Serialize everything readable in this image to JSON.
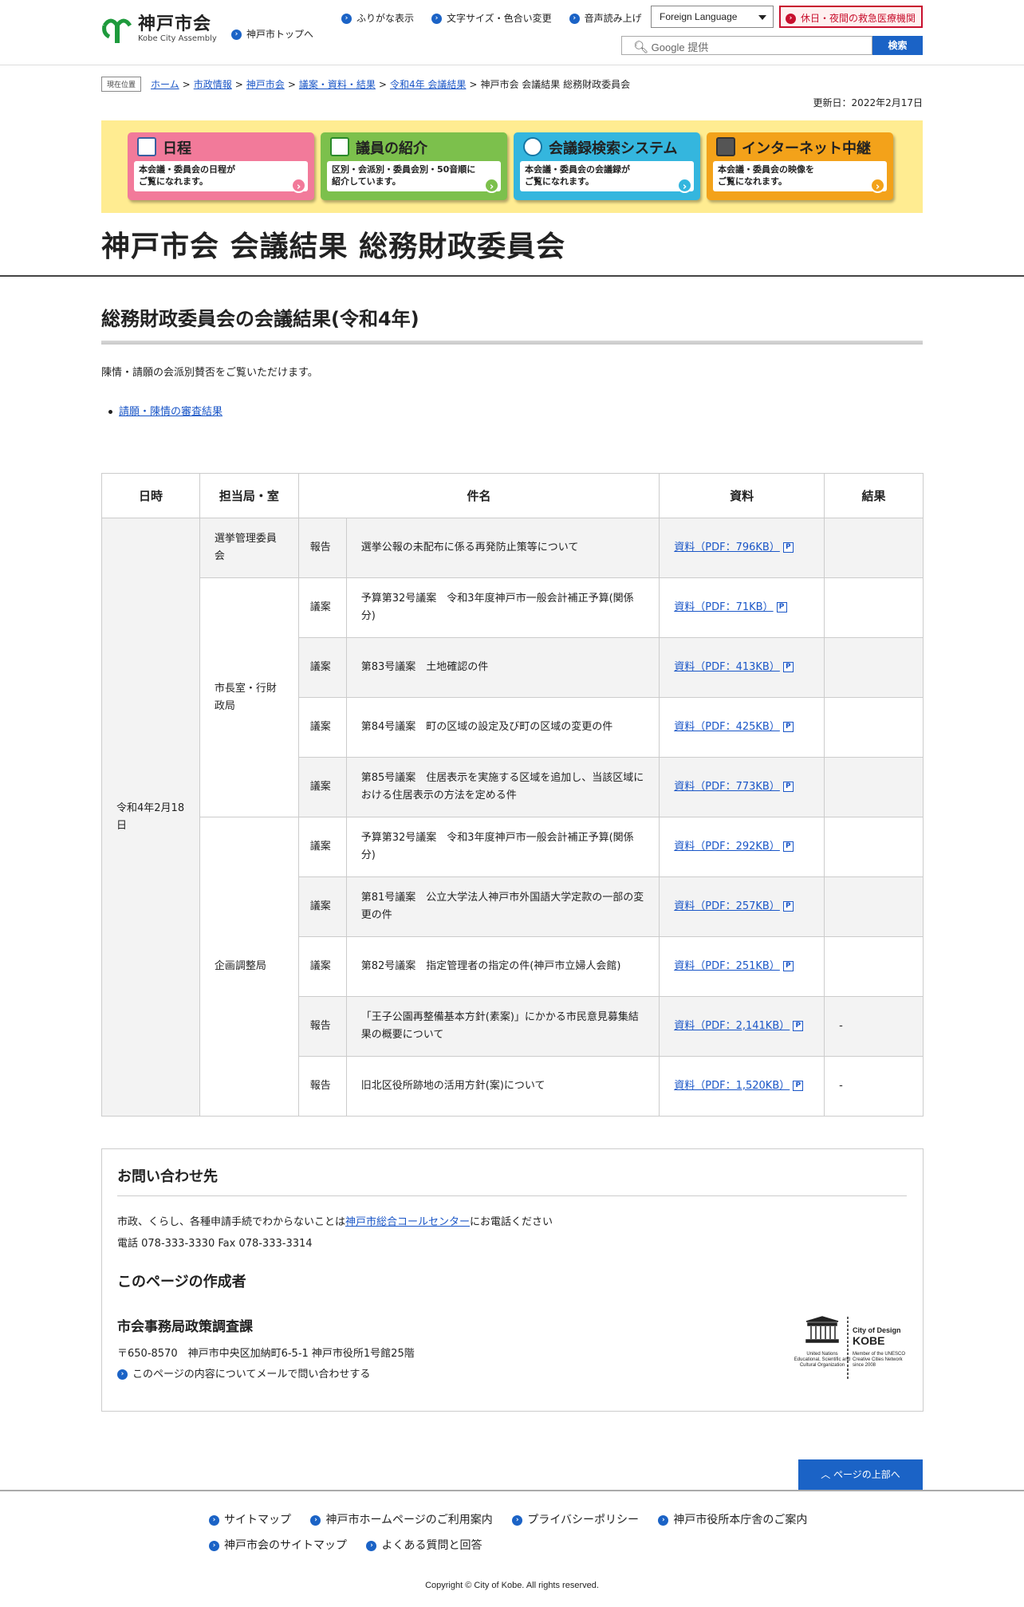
{
  "header": {
    "logo_title": "神戸市会",
    "logo_sub": "Kobe City Assembly",
    "top_link": "神戸市トップへ",
    "util": [
      "ふりがな表示",
      "文字サイズ・色合い変更",
      "音声読み上げ"
    ],
    "language": "Foreign Language",
    "emergency": "休日・夜間の救急医療機関",
    "search_placeholder": "Google 提供",
    "search_button": "検索"
  },
  "breadcrumb": {
    "here": "現在位置",
    "items": [
      "ホーム",
      "市政情報",
      "神戸市会",
      "議案・資料・結果",
      "令和4年 会議結果"
    ],
    "current": "神戸市会 会議結果 総務財政委員会"
  },
  "updated": "更新日：2022年2月17日",
  "banners": [
    {
      "title": "日程",
      "desc": "本会議・委員会の日程が\nご覧になれます。",
      "color": "#f27a9a"
    },
    {
      "title": "議員の紹介",
      "desc": "区別・会派別・委員会別・50音順に\n紹介しています。",
      "color": "#7cc04c"
    },
    {
      "title": "会議録検索システム",
      "desc": "本会議・委員会の会議録が\nご覧になれます。",
      "color": "#34b6de"
    },
    {
      "title": "インターネット中継",
      "desc": "本会議・委員会の映像を\nご覧になれます。",
      "color": "#f3a21a"
    }
  ],
  "page_title": "神戸市会 会議結果 総務財政委員会",
  "section_title": "総務財政委員会の会議結果(令和4年)",
  "intro": "陳情・請願の会派別賛否をご覧いただけます。",
  "petition_link": "請願・陳情の審査結果",
  "table": {
    "headers": [
      "日時",
      "担当局・室",
      "件名",
      "資料",
      "結果"
    ],
    "date": "令和4年2月18日",
    "depts": [
      "選挙管理委員会",
      "市長室・行財政局",
      "企画調整局"
    ],
    "rows": [
      {
        "type": "報告",
        "subject": "選挙公報の未配布に係る再発防止策等について",
        "doc": "資料（PDF：796KB）",
        "result": ""
      },
      {
        "type": "議案",
        "subject": "予算第32号議案　令和3年度神戸市一般会計補正予算(関係分)",
        "doc": "資料（PDF：71KB）",
        "result": ""
      },
      {
        "type": "議案",
        "subject": "第83号議案　土地確認の件",
        "doc": "資料（PDF：413KB）",
        "result": ""
      },
      {
        "type": "議案",
        "subject": "第84号議案　町の区域の設定及び町の区域の変更の件",
        "doc": "資料（PDF：425KB）",
        "result": ""
      },
      {
        "type": "議案",
        "subject": "第85号議案　住居表示を実施する区域を追加し、当該区域における住居表示の方法を定める件",
        "doc": "資料（PDF：773KB）",
        "result": ""
      },
      {
        "type": "議案",
        "subject": "予算第32号議案　令和3年度神戸市一般会計補正予算(関係分)",
        "doc": "資料（PDF：292KB）",
        "result": ""
      },
      {
        "type": "議案",
        "subject": "第81号議案　公立大学法人神戸市外国語大学定款の一部の変更の件",
        "doc": "資料（PDF：257KB）",
        "result": ""
      },
      {
        "type": "議案",
        "subject": "第82号議案　指定管理者の指定の件(神戸市立婦人会館)",
        "doc": "資料（PDF：251KB）",
        "result": ""
      },
      {
        "type": "報告",
        "subject": "「王子公園再整備基本方針(素案)」にかかる市民意見募集結果の概要について",
        "doc": "資料（PDF：2,141KB）",
        "result": "-"
      },
      {
        "type": "報告",
        "subject": "旧北区役所跡地の活用方針(案)について",
        "doc": "資料（PDF：1,520KB）",
        "result": "-"
      }
    ]
  },
  "contact": {
    "heading": "お問い合わせ先",
    "line1_pre": "市政、くらし、各種申請手続でわからないことは",
    "line1_link": "神戸市総合コールセンター",
    "line1_post": "にお電話ください",
    "phone": "電話 078-333-3330 Fax 078-333-3314",
    "author_heading": "このページの作成者",
    "dept": "市会事務局政策調査課",
    "address": "〒650-8570　神戸市中央区加納町6-5-1 神戸市役所1号館25階",
    "mail": "このページの内容についてメールで問い合わせする",
    "unesco": {
      "name": "UNESCO",
      "org": "United Nations\nEducational, Scientific and\nCultural Organization",
      "cod": "City of Design",
      "kobe": "KOBE",
      "member": "Member of the UNESCO\nCreative Cities Network\nsince 2008"
    }
  },
  "to_top": "ページの上部へ",
  "footer_links": [
    "サイトマップ",
    "神戸市ホームページのご利用案内",
    "プライバシーポリシー",
    "神戸市役所本庁舎のご案内",
    "神戸市会のサイトマップ",
    "よくある質問と回答"
  ],
  "copyright": "Copyright © City of Kobe. All rights reserved."
}
